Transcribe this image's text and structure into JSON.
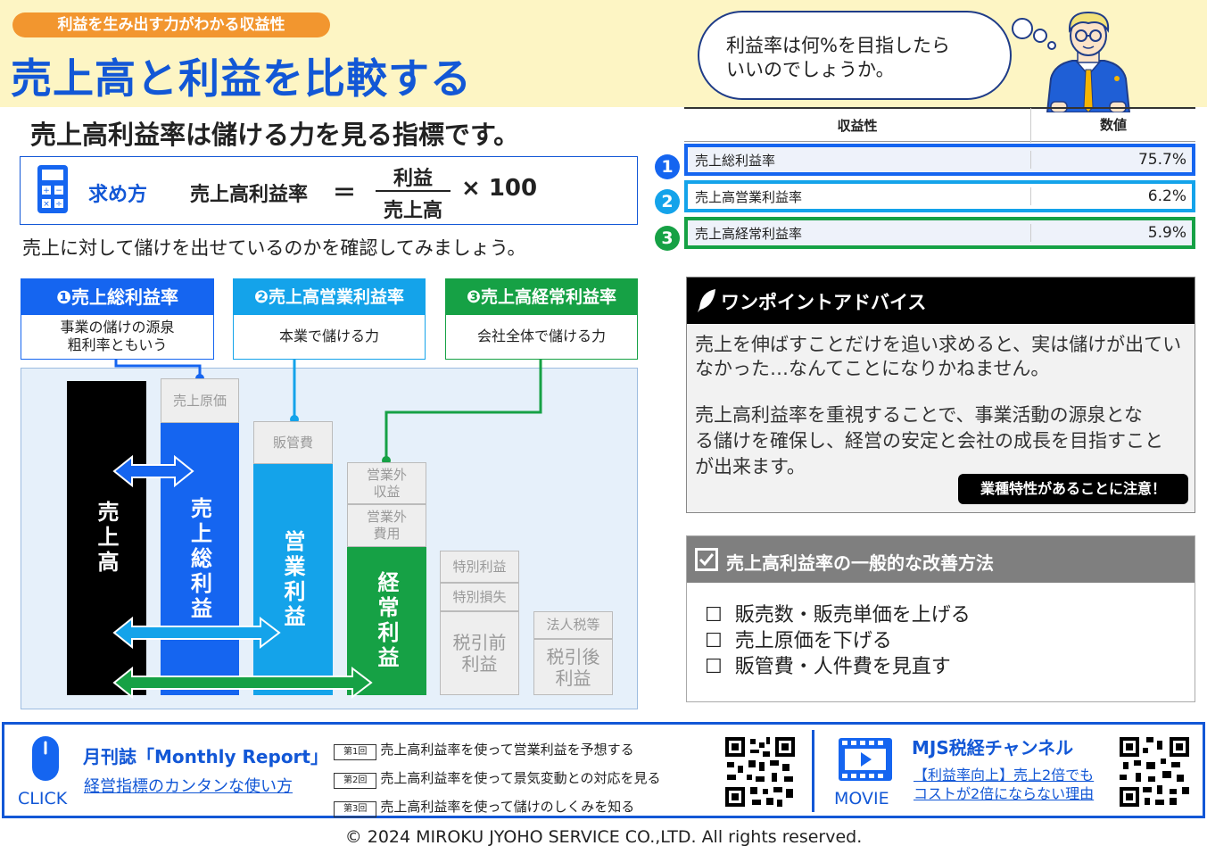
{
  "header": {
    "tag": "利益を生み出す力がわかる収益性",
    "title": "売上高と利益を比較する",
    "bubble_line1": "利益率は何%を目指したら",
    "bubble_line2": "いいのでしょうか。"
  },
  "subtitle": "売上高利益率は儲ける力を見る指標です。",
  "formula": {
    "label": "求め方",
    "lhs": "売上高利益率",
    "eq": "＝",
    "numerator": "利益",
    "denominator": "売上高",
    "multiplier": "× 100"
  },
  "intro": "売上に対して儲けを出せているのかを確認してみましょう。",
  "categories": [
    {
      "title": "❶売上総利益率",
      "desc1": "事業の儲けの源泉",
      "desc2": "粗利率ともいう",
      "color": "#1565f0"
    },
    {
      "title": "❷売上高営業利益率",
      "desc1": "本業で儲ける力",
      "desc2": "",
      "color": "#14a3ea"
    },
    {
      "title": "❸売上高経常利益率",
      "desc1": "会社全体で儲ける力",
      "desc2": "",
      "color": "#16a145"
    }
  ],
  "chart": {
    "sales": "売上高",
    "gross": "売上総利益",
    "operating": "営業利益",
    "ordinary": "経常利益",
    "cogs": "売上原価",
    "sga": "販管費",
    "non_op_income_1": "営業外",
    "non_op_income_2": "収益",
    "non_op_expense_1": "営業外",
    "non_op_expense_2": "費用",
    "special_gain": "特別利益",
    "special_loss": "特別損失",
    "pretax_1": "税引前",
    "pretax_2": "利益",
    "tax": "法人税等",
    "aftertax_1": "税引後",
    "aftertax_2": "利益"
  },
  "table": {
    "col1": "収益性",
    "col2": "数値",
    "rows": [
      {
        "num": "1",
        "label": "売上総利益率",
        "value": "75.7%",
        "color": "#1565f0"
      },
      {
        "num": "2",
        "label": "売上高営業利益率",
        "value": "6.2%",
        "color": "#14a3ea"
      },
      {
        "num": "3",
        "label": "売上高経常利益率",
        "value": "5.9%",
        "color": "#16a145"
      }
    ]
  },
  "advice": {
    "title": "ワンポイントアドバイス",
    "p1_line1": "売上を伸ばすことだけを追い求めると、実は儲けが出てい",
    "p1_line2": "なかった…なんてことになりかねません。",
    "p2_line1": "売上高利益率を重視することで、事業活動の源泉とな",
    "p2_line2": "る儲けを確保し、経営の安定と会社の成長を目指すこと",
    "p2_line3": "が出来ます。",
    "note": "業種特性があることに注意！"
  },
  "improve": {
    "title": "売上高利益率の一般的な改善方法",
    "items": [
      "販売数・販売単価を上げる",
      "売上原価を下げる",
      "販管費・人件費を見直す"
    ]
  },
  "footer": {
    "click": "CLICK",
    "magazine": "月刊誌「Monthly Report」",
    "magazine_link": "経営指標のカンタンな使い方",
    "episodes": [
      {
        "tag": "第1回",
        "text": "売上高利益率を使って営業利益を予想する"
      },
      {
        "tag": "第2回",
        "text": "売上高利益率を使って景気変動との対応を見る"
      },
      {
        "tag": "第3回",
        "text": "売上高利益率を使って儲けのしくみを知る"
      }
    ],
    "movie": "MOVIE",
    "channel": "MJS税経チャンネル",
    "channel_link1": "【利益率向上】売上2倍でも",
    "channel_link2": "コストが2倍にならない理由"
  },
  "copyright": "© 2024 MIROKU JYOHO SERVICE CO.,LTD. All rights reserved."
}
